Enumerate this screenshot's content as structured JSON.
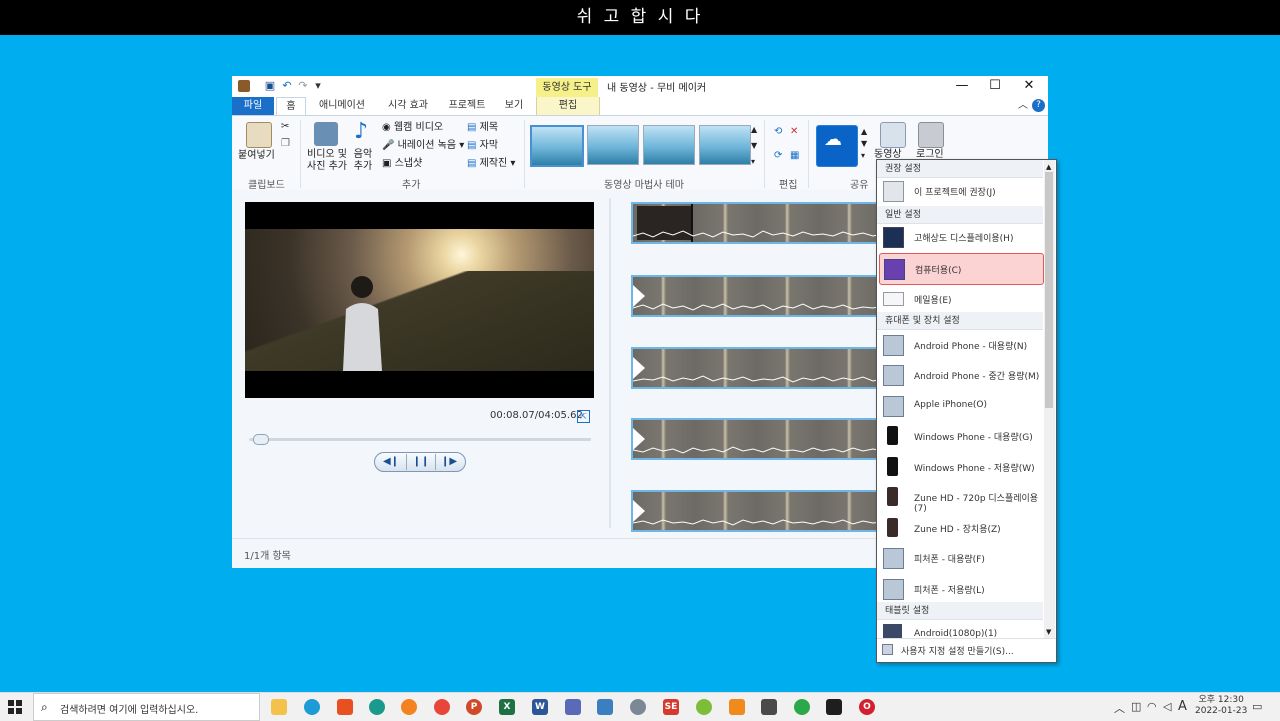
{
  "banner": "쉬 고 합 시 다",
  "window": {
    "title": "내 동영상 - 무비 메이커",
    "context_tab_group": "동영상 도구",
    "context_tab": "편집"
  },
  "tabs": [
    "파일",
    "홈",
    "애니메이션",
    "시각 효과",
    "프로젝트",
    "보기"
  ],
  "ribbon": {
    "paste": "붙여넣기",
    "clipboard_group": "클립보드",
    "add_video_l1": "비디오 및",
    "add_video_l2": "사진 추가",
    "add_music_l1": "음악",
    "add_music_l2": "추가",
    "webcam": "웹캠 비디오",
    "narration": "내레이션 녹음",
    "snapshot": "스냅샷",
    "title": "제목",
    "caption": "자막",
    "credits": "제작진",
    "add_group": "추가",
    "theme_group": "동영상 마법사 테마",
    "edit_group": "편집",
    "share_group": "공유",
    "save_movie": "동영상",
    "signin": "로그인"
  },
  "player": {
    "time": "00:08.07/04:05.62",
    "progress": 0.04
  },
  "status": "1/1개 항목",
  "menu": {
    "sections": [
      {
        "header": "권장 설정",
        "items": [
          "이 프로젝트에 권장(J)"
        ]
      },
      {
        "header": "일반 설정",
        "items": [
          "고해상도 디스플레이용(H)",
          "컴퓨터용(C)",
          "메일용(E)"
        ]
      },
      {
        "header": "휴대폰 및 장치 설정",
        "items": [
          "Android Phone - 대용량(N)",
          "Android Phone - 중간 용량(M)",
          "Apple iPhone(O)",
          "Windows Phone - 대용량(G)",
          "Windows Phone - 저용량(W)",
          "Zune HD - 720p 디스플레이용(7)",
          "Zune HD - 장치용(Z)",
          "피처폰 - 대용량(F)",
          "피처폰 - 저용량(L)"
        ]
      },
      {
        "header": "태블릿 설정",
        "items": [
          "Android(1080p)(1)"
        ]
      }
    ],
    "footer": "사용자 지정 설정 만들기(S)..."
  },
  "taskbar": {
    "search_placeholder": "검색하려면 여기에 입력하십시오.",
    "clock_time": "오후 12:30",
    "clock_date": "2022-01-23",
    "ime": "A"
  },
  "colors": {
    "desktop": "#00aef0",
    "accent": "#1a6fc9",
    "highlight": "#fbd3d3"
  }
}
